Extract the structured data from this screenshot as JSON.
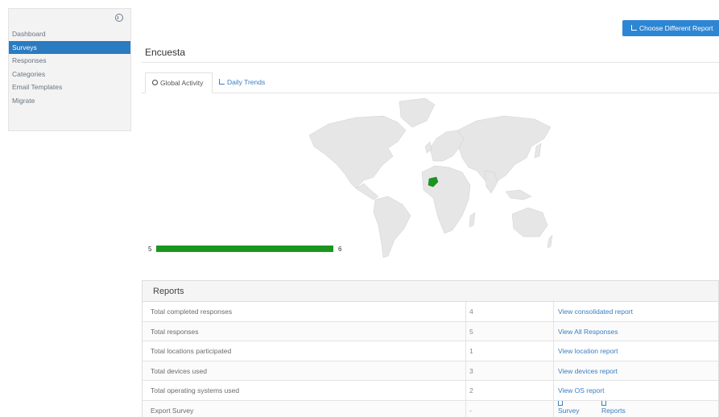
{
  "sidebar": {
    "items": [
      {
        "label": "Dashboard",
        "active": false
      },
      {
        "label": "Surveys",
        "active": true
      },
      {
        "label": "Responses",
        "active": false
      },
      {
        "label": "Categories",
        "active": false
      },
      {
        "label": "Email Templates",
        "active": false
      },
      {
        "label": "Migrate",
        "active": false
      }
    ]
  },
  "header": {
    "report_button_label": "Choose Different Report",
    "page_title": "Encuesta"
  },
  "tabs": [
    {
      "label": "Global Activity",
      "icon": "globe-icon",
      "active": true
    },
    {
      "label": "Daily Trends",
      "icon": "line-chart-icon",
      "active": false
    }
  ],
  "map": {
    "highlight_color": "#1a961f",
    "base_color": "#e6e6e6",
    "scale_min": "5",
    "scale_max": "6"
  },
  "reports": {
    "title": "Reports",
    "rows": [
      {
        "label": "Total completed responses",
        "value": "4",
        "link": "View consolidated report"
      },
      {
        "label": "Total responses",
        "value": "5",
        "link": "View All Responses"
      },
      {
        "label": "Total locations participated",
        "value": "1",
        "link": "View location report"
      },
      {
        "label": "Total devices used",
        "value": "3",
        "link": "View devices report"
      },
      {
        "label": "Total operating systems used",
        "value": "2",
        "link": "View OS report"
      }
    ],
    "export": {
      "label": "Export Survey",
      "value": "-",
      "survey_link": "Survey",
      "reports_link": "Reports"
    }
  }
}
